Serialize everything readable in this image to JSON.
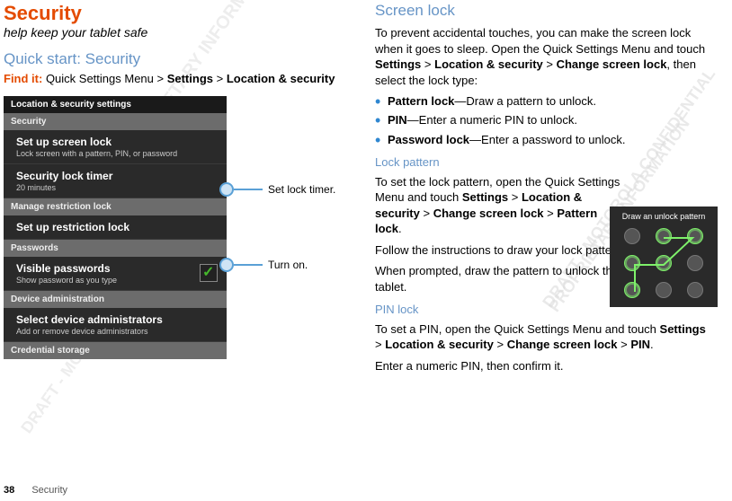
{
  "left": {
    "title": "Security",
    "tagline": "help keep your tablet safe",
    "quick_start_heading": "Quick start: Security",
    "findit_label": "Find it:",
    "findit_text_1": " Quick Settings Menu > ",
    "findit_strong_settings": "Settings",
    "findit_gt1": " > ",
    "findit_strong_loc": "Location & security",
    "phone": {
      "header": "Location & security settings",
      "section_security": "Security",
      "row_screen_lock_title": "Set up screen lock",
      "row_screen_lock_desc": "Lock screen with a pattern, PIN, or password",
      "row_timer_title": "Security lock timer",
      "row_timer_desc": "20 minutes",
      "section_restriction": "Manage restriction lock",
      "row_restriction_title": "Set up restriction lock",
      "section_passwords": "Passwords",
      "row_visible_title": "Visible passwords",
      "row_visible_desc": "Show password as you type",
      "section_device_admin": "Device administration",
      "row_admin_title": "Select device administrators",
      "row_admin_desc": "Add or remove device administrators",
      "section_credential": "Credential storage"
    },
    "callout_timer": "Set lock timer.",
    "callout_turnon": "Turn on."
  },
  "right": {
    "screen_lock_heading": "Screen lock",
    "screen_lock_body_1": "To prevent accidental touches, you can make the screen lock when it goes to sleep. Open the Quick Settings Menu and touch ",
    "settings": "Settings",
    "gt": " > ",
    "locsec": "Location & security",
    "change_lock": "Change screen lock",
    "screen_lock_body_2": ", then select the lock type:",
    "li_pattern_strong": "Pattern lock",
    "li_pattern_tail": "—Draw a pattern to unlock.",
    "li_pin_strong": "PIN",
    "li_pin_tail": "—Enter a numeric PIN to unlock.",
    "li_pw_strong": "Password lock",
    "li_pw_tail": "—Enter a password to unlock.",
    "lock_pattern_heading": "Lock pattern",
    "lock_pattern_body_1a": "To set the lock pattern, open the Quick Settings Menu and touch ",
    "pattern_lock_strong": "Pattern lock",
    "lock_pattern_body_1b": ".",
    "lock_pattern_body_2": "Follow the instructions to draw your lock pattern.",
    "lock_pattern_body_3": "When prompted, draw the pattern to unlock the tablet.",
    "pattern_box_label": "Draw an unlock pattern",
    "pin_lock_heading": "PIN lock",
    "pin_lock_body_1a": "To set a PIN, open the Quick Settings Menu and touch ",
    "pin_strong": "PIN",
    "pin_lock_body_1b": ".",
    "pin_lock_body_2": "Enter a numeric PIN, then confirm it."
  },
  "watermark": {
    "line1": "DRAFT - MOTOROLA CONFIDENTIAL",
    "line2": "PROPRIETARY INFORMATION"
  },
  "footer": {
    "page": "38",
    "section": "Security"
  }
}
